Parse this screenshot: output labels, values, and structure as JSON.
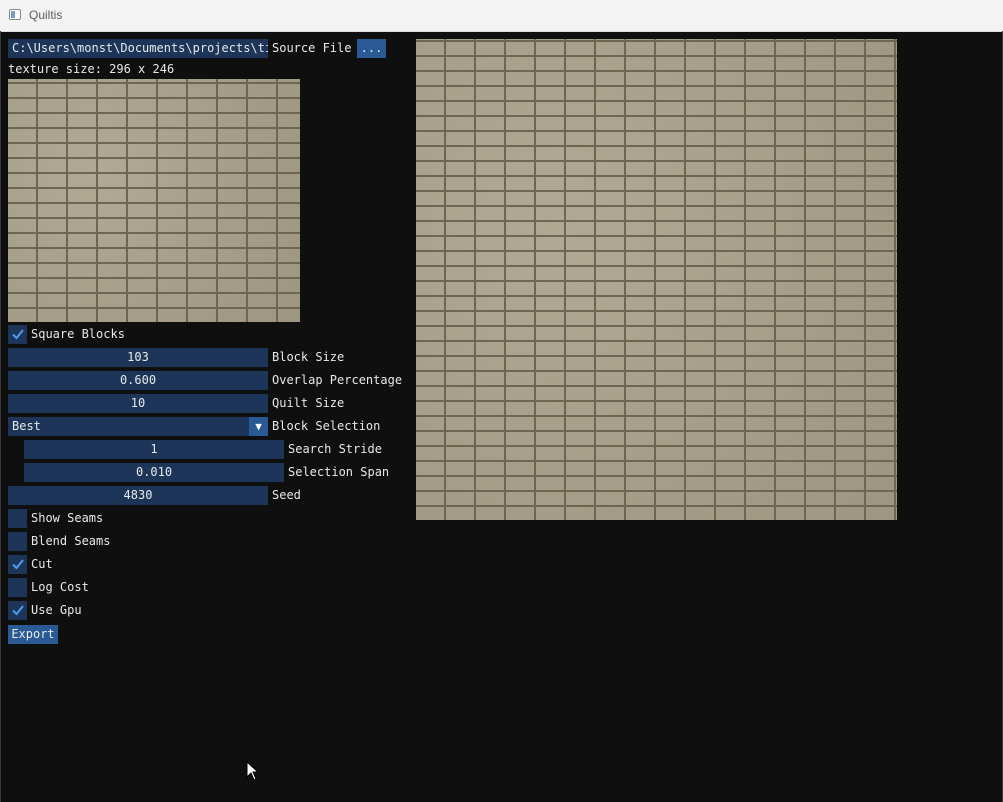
{
  "window": {
    "title": "Quiltis",
    "app_icon": "window-icon"
  },
  "source": {
    "path": "C:\\Users\\monst\\Documents\\projects\\ti",
    "label": "Source File",
    "browse_label": "...",
    "texture_size": "texture size: 296 x 246"
  },
  "controls": {
    "square_blocks": {
      "label": "Square Blocks",
      "checked": true
    },
    "block_size": {
      "value": "103",
      "label": "Block Size"
    },
    "overlap": {
      "value": "0.600",
      "label": "Overlap Percentage"
    },
    "quilt_size": {
      "value": "10",
      "label": "Quilt Size"
    },
    "block_selection": {
      "value": "Best",
      "label": "Block Selection"
    },
    "search_stride": {
      "value": "1",
      "label": "Search Stride"
    },
    "selection_span": {
      "value": "0.010",
      "label": "Selection Span"
    },
    "seed": {
      "value": "4830",
      "label": "Seed"
    },
    "show_seams": {
      "label": "Show Seams",
      "checked": false
    },
    "blend_seams": {
      "label": "Blend Seams",
      "checked": false
    },
    "cut": {
      "label": "Cut",
      "checked": true
    },
    "log_cost": {
      "label": "Log Cost",
      "checked": false
    },
    "use_gpu": {
      "label": "Use Gpu",
      "checked": true
    },
    "export_label": "Export"
  },
  "colors": {
    "background": "#0f0f0f",
    "field": "#1d3558",
    "button": "#295a96",
    "checkmark": "#4f9bef"
  }
}
